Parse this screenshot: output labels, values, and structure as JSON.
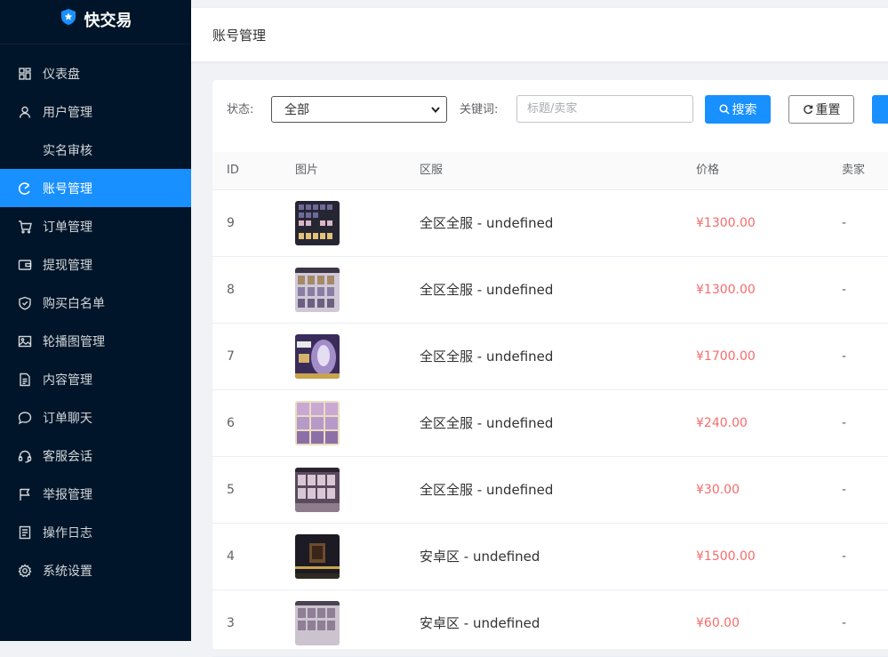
{
  "brand": {
    "name": "快交易"
  },
  "sidebar": {
    "items": [
      {
        "label": "仪表盘",
        "icon": "dashboard-icon"
      },
      {
        "label": "用户管理",
        "icon": "user-icon"
      },
      {
        "label": "实名审核",
        "icon": ""
      },
      {
        "label": "账号管理",
        "icon": "account-icon"
      },
      {
        "label": "订单管理",
        "icon": "cart-icon"
      },
      {
        "label": "提现管理",
        "icon": "wallet-icon"
      },
      {
        "label": "购买白名单",
        "icon": "shield-icon"
      },
      {
        "label": "轮播图管理",
        "icon": "image-icon"
      },
      {
        "label": "内容管理",
        "icon": "document-icon"
      },
      {
        "label": "订单聊天",
        "icon": "chat-icon"
      },
      {
        "label": "客服会话",
        "icon": "headset-icon"
      },
      {
        "label": "举报管理",
        "icon": "flag-icon"
      },
      {
        "label": "操作日志",
        "icon": "log-icon"
      },
      {
        "label": "系统设置",
        "icon": "gear-icon"
      }
    ],
    "active_index": 3
  },
  "header": {
    "title": "账号管理"
  },
  "filter": {
    "status_label": "状态:",
    "status_value": "全部",
    "keyword_label": "关键词:",
    "keyword_placeholder": "标题/卖家",
    "search_button": "搜索",
    "reset_button": "重置"
  },
  "table": {
    "headers": {
      "id": "ID",
      "image": "图片",
      "region": "区服",
      "price": "价格",
      "seller": "卖家"
    },
    "rows": [
      {
        "id": "9",
        "region": "全区全服 - undefined",
        "price": "¥1300.00",
        "seller": "-"
      },
      {
        "id": "8",
        "region": "全区全服 - undefined",
        "price": "¥1300.00",
        "seller": "-"
      },
      {
        "id": "7",
        "region": "全区全服 - undefined",
        "price": "¥1700.00",
        "seller": "-"
      },
      {
        "id": "6",
        "region": "全区全服 - undefined",
        "price": "¥240.00",
        "seller": "-"
      },
      {
        "id": "5",
        "region": "全区全服 - undefined",
        "price": "¥30.00",
        "seller": "-"
      },
      {
        "id": "4",
        "region": "安卓区 - undefined",
        "price": "¥1500.00",
        "seller": "-"
      },
      {
        "id": "3",
        "region": "安卓区 - undefined",
        "price": "¥60.00",
        "seller": "-"
      }
    ]
  },
  "colors": {
    "sidebar_bg": "#001529",
    "accent": "#1890ff",
    "price": "#f56c6c"
  }
}
